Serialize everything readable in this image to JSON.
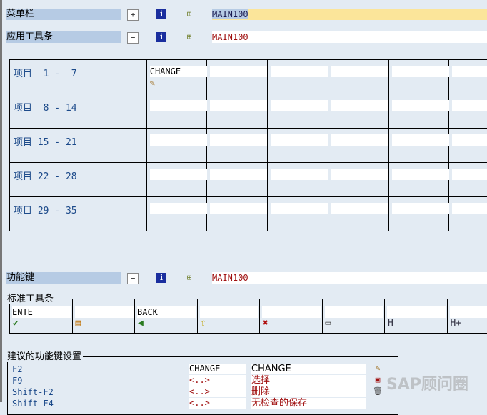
{
  "menu_bar": {
    "label": "菜单栏",
    "value": "MAIN100",
    "icons": [
      "expand-icon",
      "info-icon",
      "hierarchy-icon"
    ]
  },
  "app_toolbar": {
    "label": "应用工具条",
    "value": "MAIN100"
  },
  "items": {
    "rows": [
      {
        "label": "项目  1 -  7",
        "cells": [
          "CHANGE",
          "",
          "",
          "",
          "",
          ""
        ]
      },
      {
        "label": "项目  8 - 14",
        "cells": [
          "",
          "",
          "",
          "",
          "",
          ""
        ]
      },
      {
        "label": "项目 15 - 21",
        "cells": [
          "",
          "",
          "",
          "",
          "",
          ""
        ]
      },
      {
        "label": "项目 22 - 28",
        "cells": [
          "",
          "",
          "",
          "",
          "",
          ""
        ]
      },
      {
        "label": "项目 29 - 35",
        "cells": [
          "",
          "",
          "",
          "",
          "",
          ""
        ]
      }
    ]
  },
  "function_keys": {
    "label": "功能键",
    "value": "MAIN100"
  },
  "standard_toolbar": {
    "title": "标准工具条",
    "buttons": [
      {
        "code": "ENTE",
        "icon": "check-icon"
      },
      {
        "code": "",
        "icon": "save-icon"
      },
      {
        "code": "BACK",
        "icon": "back-icon"
      },
      {
        "code": "",
        "icon": "exit-icon"
      },
      {
        "code": "",
        "icon": "cancel-icon"
      },
      {
        "code": "",
        "icon": "print-icon"
      },
      {
        "code": "",
        "icon": "find-icon"
      },
      {
        "code": "",
        "icon": "find-next-icon"
      }
    ]
  },
  "suggested": {
    "title": "建议的功能键设置",
    "rows": [
      {
        "key": "F2",
        "code": "CHANGE",
        "text": "CHANGE"
      },
      {
        "key": "F9",
        "code": "<..>",
        "text": "选择"
      },
      {
        "key": "Shift-F2",
        "code": "<..>",
        "text": "删除"
      },
      {
        "key": "Shift-F4",
        "code": "<..>",
        "text": "无检查的保存"
      }
    ]
  },
  "watermark": "SAP顾问圈"
}
